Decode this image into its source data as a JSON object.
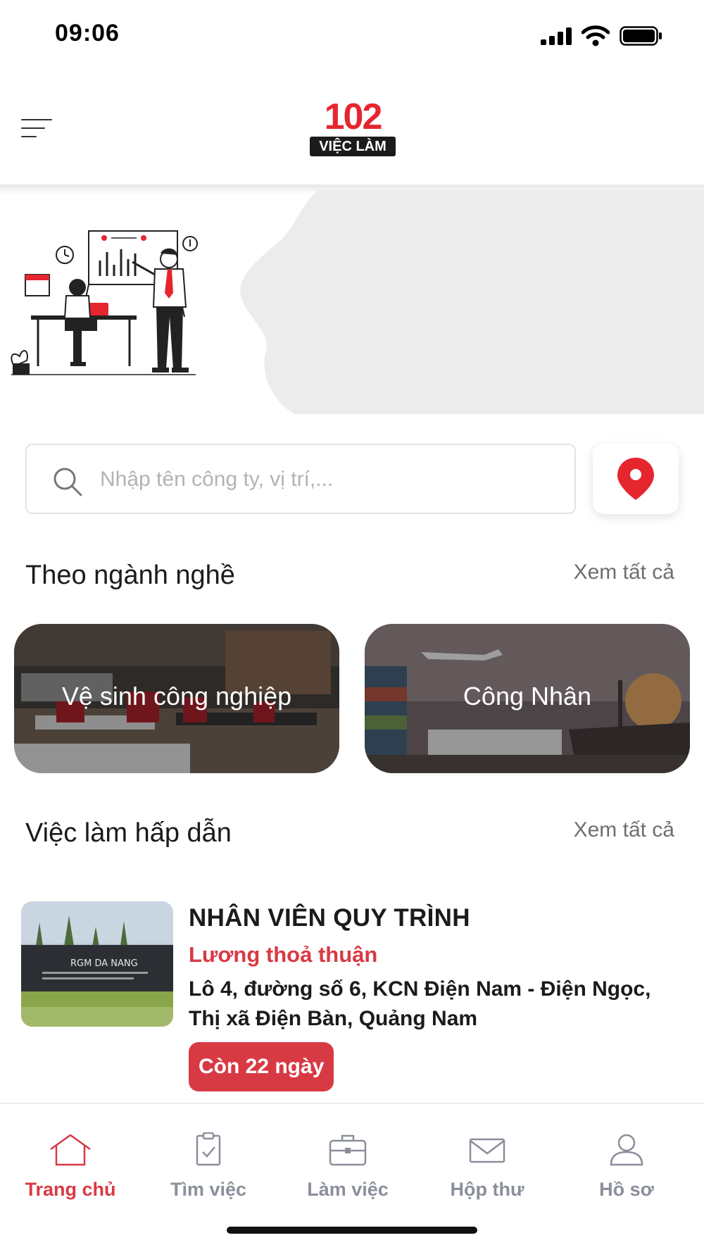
{
  "status_bar": {
    "time": "09:06"
  },
  "header": {
    "logo_number": "102",
    "logo_tagline": "VIỆC LÀM"
  },
  "search": {
    "placeholder": "Nhập tên công ty, vị trí,..."
  },
  "categories_section": {
    "title": "Theo ngành nghề",
    "see_all": "Xem tất cả",
    "items": [
      {
        "label": "Vệ sinh công nghiệp"
      },
      {
        "label": "Công Nhân"
      }
    ]
  },
  "jobs_section": {
    "title": "Việc làm hấp dẫn",
    "see_all": "Xem tất cả",
    "jobs": [
      {
        "title": "NHÂN VIÊN QUY TRÌNH",
        "salary": "Lương thoả thuận",
        "address": "Lô 4, đường số 6, KCN Điện Nam - Điện Ngọc, Thị xã Điện Bàn, Quảng Nam",
        "remaining": "Còn 22 ngày",
        "company_sign": "RGM DA NANG"
      }
    ]
  },
  "bottom_nav": {
    "items": [
      {
        "label": "Trang chủ",
        "icon": "home-icon",
        "active": true
      },
      {
        "label": "Tìm việc",
        "icon": "clipboard-check-icon",
        "active": false
      },
      {
        "label": "Làm việc",
        "icon": "briefcase-icon",
        "active": false
      },
      {
        "label": "Hộp thư",
        "icon": "mail-icon",
        "active": false
      },
      {
        "label": "Hồ sơ",
        "icon": "user-icon",
        "active": false
      }
    ]
  },
  "colors": {
    "accent": "#d83a44",
    "brand_red": "#e5262f",
    "nav_inactive": "#8b8f9b"
  }
}
